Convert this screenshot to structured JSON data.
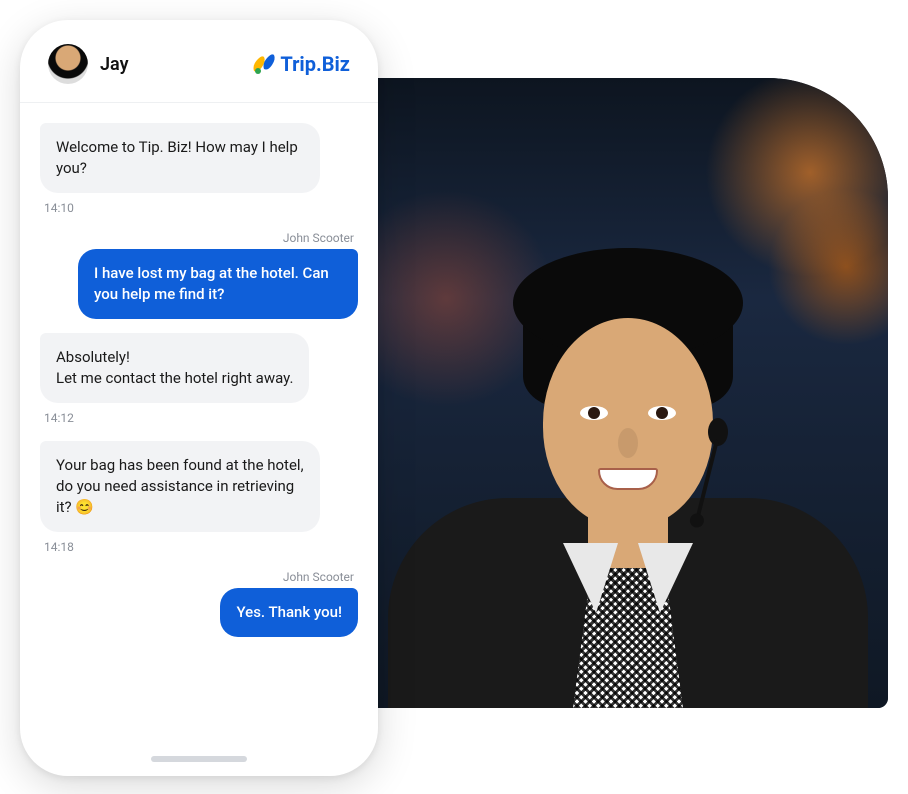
{
  "header": {
    "agent_name": "Jay",
    "brand_name": "Trip.Biz"
  },
  "messages": [
    {
      "side": "left",
      "role": "agent",
      "text": "Welcome to Tip. Biz! How may I help you?",
      "timestamp": "14:10"
    },
    {
      "side": "right",
      "role": "user",
      "sender": "John Scooter",
      "text": "I have lost my bag at the hotel. Can you help me find it?"
    },
    {
      "side": "left",
      "role": "agent",
      "text": "Absolutely!\nLet me contact the hotel right away.",
      "timestamp": "14:12"
    },
    {
      "side": "left",
      "role": "agent",
      "text": "Your bag has been found at the hotel, do you need assistance in retrieving it? 😊",
      "timestamp": "14:18"
    },
    {
      "side": "right",
      "role": "user",
      "sender": "John Scooter",
      "text": "Yes. Thank you!"
    }
  ]
}
